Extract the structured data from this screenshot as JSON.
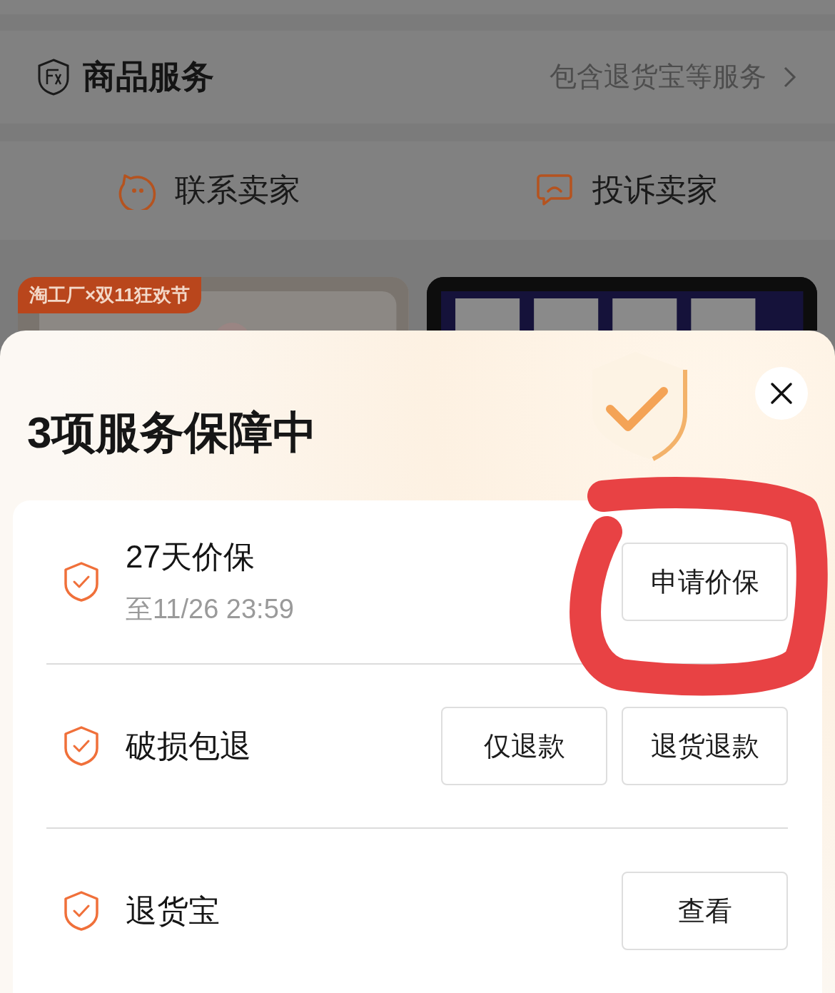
{
  "product_service": {
    "title": "商品服务",
    "summary": "包含退货宝等服务"
  },
  "seller_actions": [
    {
      "label": "联系卖家",
      "kind": "contact"
    },
    {
      "label": "投诉卖家",
      "kind": "complain"
    }
  ],
  "feed": [
    {
      "kind": "picture",
      "tag": "淘工厂×双11狂欢节"
    },
    {
      "kind": "picture"
    }
  ],
  "sheet": {
    "title": "3项服务保障中",
    "services": [
      {
        "name": "27天价保",
        "until": "至11/26 23:59",
        "actions": [
          "申请价保"
        ]
      },
      {
        "name": "破损包退",
        "actions": [
          "仅退款",
          "退货退款"
        ]
      },
      {
        "name": "退货宝",
        "actions": [
          "查看"
        ]
      }
    ]
  }
}
